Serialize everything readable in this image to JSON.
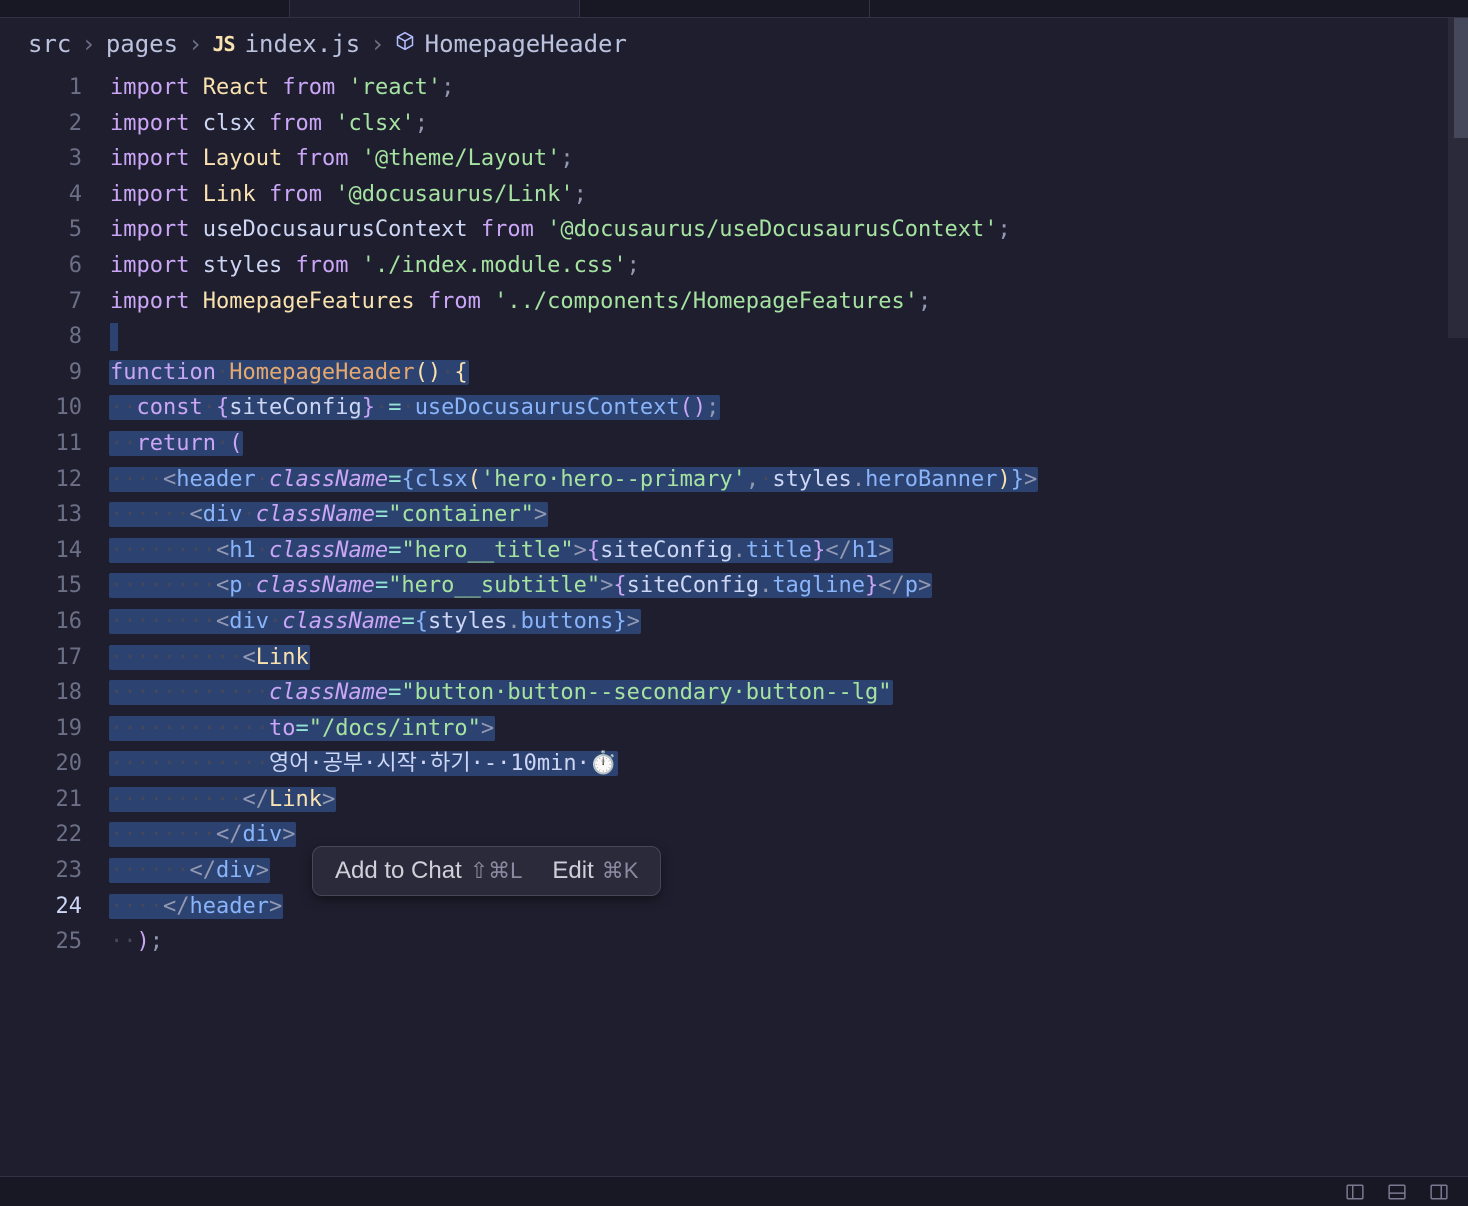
{
  "breadcrumb": {
    "part0": "src",
    "part1": "pages",
    "file_icon": "JS",
    "file": "index.js",
    "symbol_icon": "cube",
    "symbol": "HomepageHeader"
  },
  "lines": {
    "l1": {
      "n": "1"
    },
    "l2": {
      "n": "2"
    },
    "l3": {
      "n": "3"
    },
    "l4": {
      "n": "4"
    },
    "l5": {
      "n": "5"
    },
    "l6": {
      "n": "6"
    },
    "l7": {
      "n": "7"
    },
    "l8": {
      "n": "8"
    },
    "l9": {
      "n": "9"
    },
    "l10": {
      "n": "10"
    },
    "l11": {
      "n": "11"
    },
    "l12": {
      "n": "12"
    },
    "l13": {
      "n": "13"
    },
    "l14": {
      "n": "14"
    },
    "l15": {
      "n": "15"
    },
    "l16": {
      "n": "16"
    },
    "l17": {
      "n": "17"
    },
    "l18": {
      "n": "18"
    },
    "l19": {
      "n": "19"
    },
    "l20": {
      "n": "20"
    },
    "l21": {
      "n": "21"
    },
    "l22": {
      "n": "22"
    },
    "l23": {
      "n": "23"
    },
    "l24": {
      "n": "24"
    },
    "l25": {
      "n": "25"
    }
  },
  "code": {
    "kw_import": "import",
    "kw_from": "from",
    "kw_function": "function",
    "kw_const": "const",
    "kw_return": "return",
    "ident_React": "React",
    "ident_clsx": "clsx",
    "ident_Layout": "Layout",
    "ident_Link": "Link",
    "ident_useCtx": "useDocusaurusContext",
    "ident_styles": "styles",
    "ident_HomepageFeatures": "HomepageFeatures",
    "fn_HomepageHeader": "HomepageHeader",
    "ident_siteConfig": "siteConfig",
    "str_react": "'react'",
    "str_clsx": "'clsx'",
    "str_themeLayout": "'@theme/Layout'",
    "str_docLink": "'@docusaurus/Link'",
    "str_docCtx": "'@docusaurus/useDocusaurusContext'",
    "str_indexMod": "'./index.module.css'",
    "str_compFeatures": "'../components/HomepageFeatures'",
    "str_heroPrimary": "'hero·hero--primary'",
    "str_container": "\"container\"",
    "str_heroTitle": "\"hero__title\"",
    "str_heroSubtitle": "\"hero__subtitle\"",
    "str_buttonCls": "\"button·button--secondary·button--lg\"",
    "str_docsIntro": "\"/docs/intro\"",
    "attr_className": "className",
    "attr_to": "to",
    "tag_header": "header",
    "tag_div": "div",
    "tag_h1": "h1",
    "tag_p": "p",
    "tag_Link": "Link",
    "mem_heroBanner": "heroBanner",
    "mem_title": "title",
    "mem_tagline": "tagline",
    "mem_buttons": "buttons",
    "link_text": "영어·공부·시작·하기·-·10min·⏱️",
    "semi": ";",
    "comma": ",",
    "dot": ".",
    "eq": "=",
    "lpar": "(",
    "rpar": ")",
    "lbr": "{",
    "rbr": "}",
    "lang": "<",
    "rang": ">",
    "slash": "/",
    "ws2": "··",
    "ws4": "····",
    "ws6": "······",
    "ws8": "········",
    "ws10": "··········",
    "ws12": "············",
    "sp": "·"
  },
  "floating": {
    "add_label": "Add to Chat",
    "add_shortcut": "⇧⌘L",
    "edit_label": "Edit",
    "edit_shortcut": "⌘K"
  }
}
